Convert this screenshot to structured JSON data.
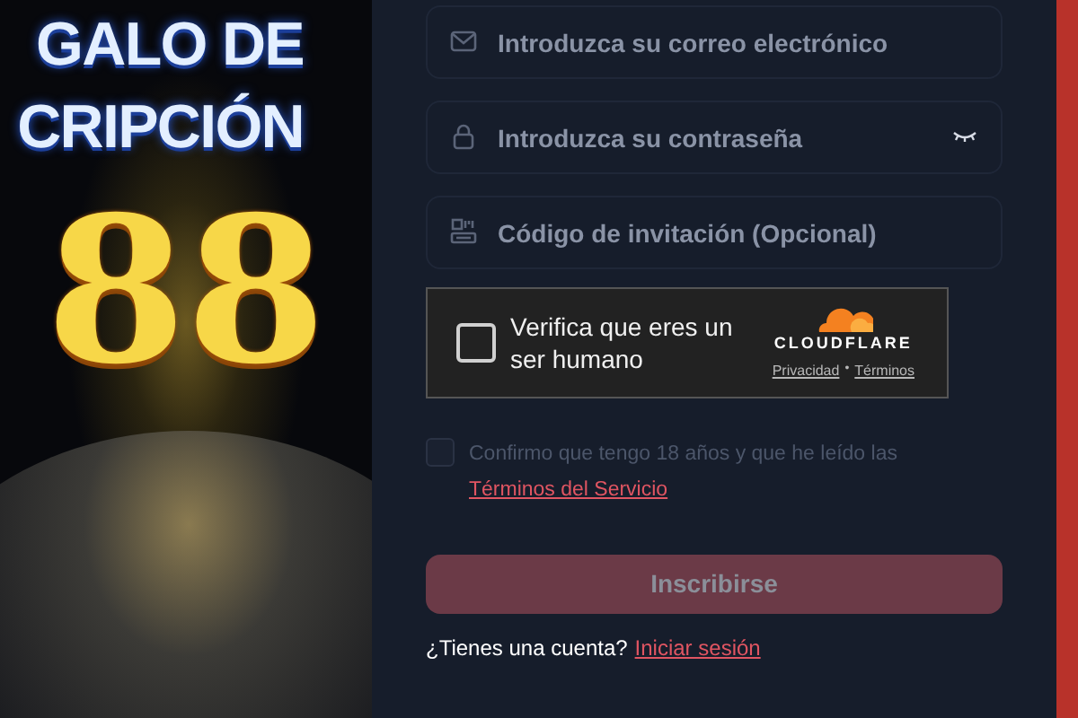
{
  "banner": {
    "title_lines": [
      "GALO DE",
      "CRIPCIÓN"
    ],
    "number": "88"
  },
  "form": {
    "fields": [
      {
        "kind": "email",
        "placeholder": "Introduzca su correo electrónico"
      },
      {
        "kind": "password",
        "placeholder": "Introduzca su contraseña"
      },
      {
        "kind": "invite",
        "placeholder": "Código de invitación (Opcional)"
      }
    ],
    "captcha": {
      "label": "Verifica que eres un ser humano",
      "checked": false,
      "brand": "CLOUDFLARE",
      "privacy": "Privacidad",
      "separator": "•",
      "terms": "Términos"
    },
    "consent": {
      "checked": false,
      "text": "Confirmo que tengo 18 años y que he leído las",
      "link": "Términos del Servicio"
    },
    "submit": {
      "label": "Inscribirse",
      "disabled": true
    },
    "footer": {
      "text": "¿Tienes una cuenta?",
      "link": "Iniciar sesión"
    }
  }
}
